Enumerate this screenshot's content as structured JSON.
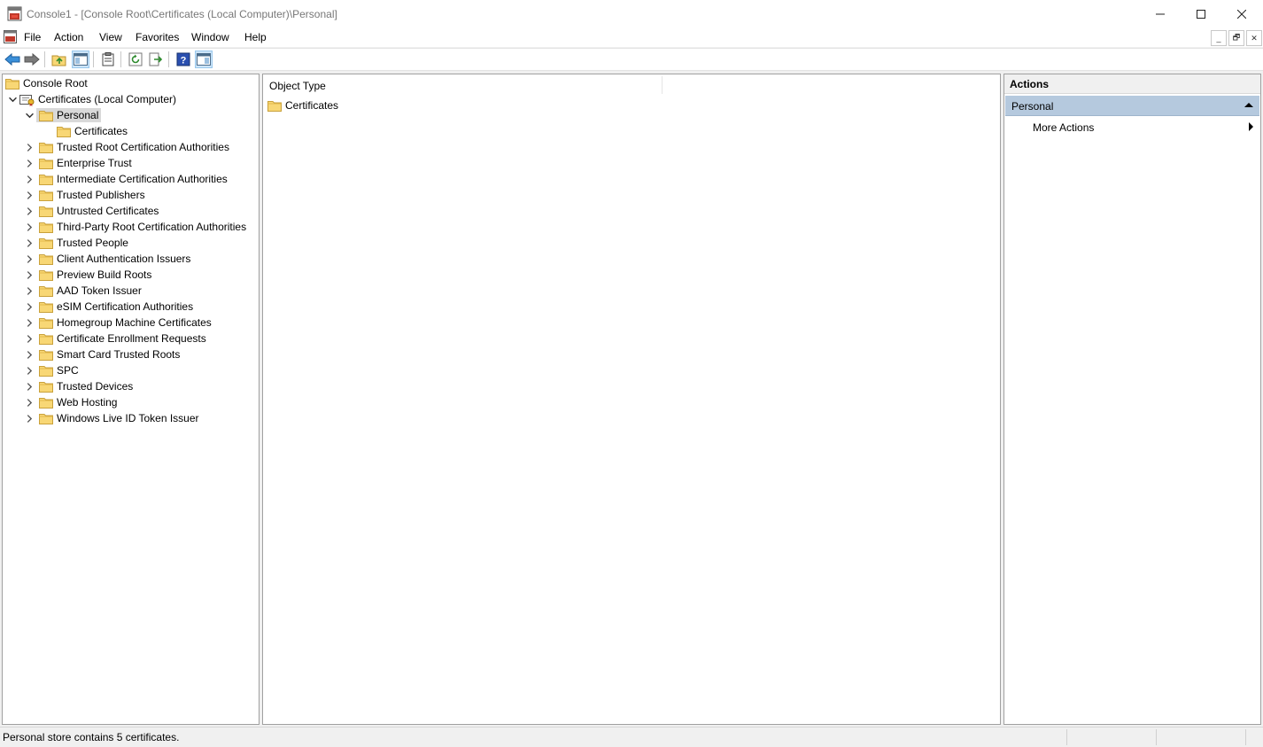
{
  "window": {
    "title": "Console1 - [Console Root\\Certificates (Local Computer)\\Personal]",
    "minimize_label": "—",
    "maximize_label": "☐",
    "close_label": "✕"
  },
  "menubar": {
    "items": [
      "File",
      "Action",
      "View",
      "Favorites",
      "Window",
      "Help"
    ],
    "mdi_minimize": "_",
    "mdi_restore": "🗗",
    "mdi_close": "✕"
  },
  "toolbar": {
    "buttons": [
      "back-icon",
      "forward-icon",
      "up-one-level-icon",
      "show-hide-console-tree-icon",
      "properties-icon",
      "refresh-icon",
      "export-list-icon",
      "help-icon",
      "show-hide-action-pane-icon"
    ]
  },
  "tree": {
    "root": "Console Root",
    "computer": "Certificates (Local Computer)",
    "selected": "Personal",
    "child": "Certificates",
    "stores": [
      "Trusted Root Certification Authorities",
      "Enterprise Trust",
      "Intermediate Certification Authorities",
      "Trusted Publishers",
      "Untrusted Certificates",
      "Third-Party Root Certification Authorities",
      "Trusted People",
      "Client Authentication Issuers",
      "Preview Build Roots",
      "AAD Token Issuer",
      "eSIM Certification Authorities",
      "Homegroup Machine Certificates",
      "Certificate Enrollment Requests",
      "Smart Card Trusted Roots",
      "SPC",
      "Trusted Devices",
      "Web Hosting",
      "Windows Live ID Token Issuer"
    ]
  },
  "list": {
    "column": "Object Type",
    "rows": [
      "Certificates"
    ]
  },
  "actions": {
    "title": "Actions",
    "section": "Personal",
    "more": "More Actions"
  },
  "status": {
    "text": "Personal store contains 5 certificates."
  },
  "colors": {
    "accent_section": "#b5c9de",
    "folder": "#f5d77a",
    "selection": "#d9d9d9"
  }
}
